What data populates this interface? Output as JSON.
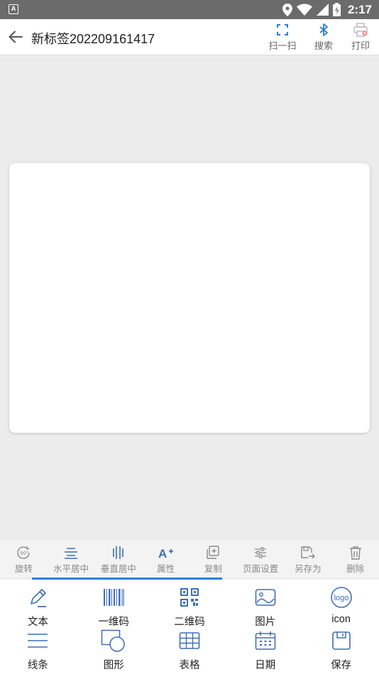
{
  "status_bar": {
    "notification_glyph": "A",
    "time": "2:17",
    "icons": [
      "location-icon",
      "wifi-icon",
      "signal-icon",
      "battery-icon"
    ]
  },
  "header": {
    "title": "新标签202209161417",
    "actions": [
      {
        "label": "扫一扫",
        "icon": "scan-icon"
      },
      {
        "label": "搜索",
        "icon": "bluetooth-icon"
      },
      {
        "label": "打印",
        "icon": "printer-icon"
      }
    ]
  },
  "edit_toolbar": {
    "items": [
      {
        "label": "旋转",
        "icon": "rotate-icon"
      },
      {
        "label": "水平居中",
        "icon": "align-horizontal-center-icon"
      },
      {
        "label": "垂直居中",
        "icon": "align-vertical-center-icon"
      },
      {
        "label": "属性",
        "icon": "text-attributes-icon"
      },
      {
        "label": "复制",
        "icon": "copy-icon"
      },
      {
        "label": "页面设置",
        "icon": "settings-sliders-icon"
      },
      {
        "label": "另存为",
        "icon": "save-as-icon"
      },
      {
        "label": "删除",
        "icon": "trash-icon"
      }
    ]
  },
  "palette": {
    "row1": [
      {
        "label": "文本",
        "icon": "pencil-icon"
      },
      {
        "label": "一维码",
        "icon": "barcode-icon"
      },
      {
        "label": "二维码",
        "icon": "qrcode-icon"
      },
      {
        "label": "图片",
        "icon": "image-icon"
      },
      {
        "label": "icon",
        "icon": "logo-icon",
        "icon_text": "logo"
      }
    ],
    "row2": [
      {
        "label": "线条",
        "icon": "lines-icon"
      },
      {
        "label": "图形",
        "icon": "shapes-icon"
      },
      {
        "label": "表格",
        "icon": "table-icon"
      },
      {
        "label": "日期",
        "icon": "calendar-icon"
      },
      {
        "label": "保存",
        "icon": "save-icon"
      }
    ]
  },
  "colors": {
    "accent": "#2d7fd3",
    "icon_blue": "#3f6fb5",
    "toolbar_gray": "#8a8a8a",
    "status_bar": "#6b6b6b",
    "background": "#ececec"
  }
}
